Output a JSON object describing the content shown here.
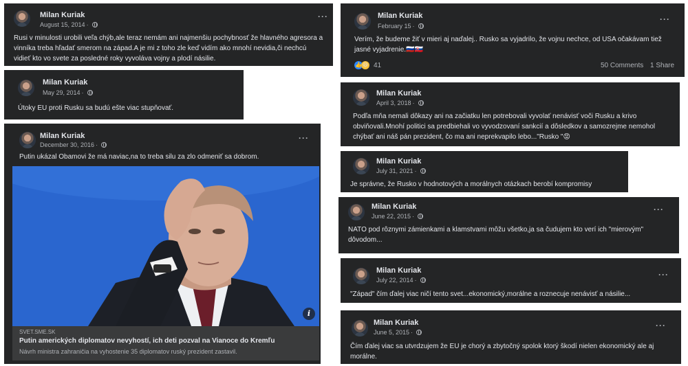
{
  "author": "Milan Kuriak",
  "more_label": "···",
  "posts": [
    {
      "id": "p1",
      "date": "August 15, 2014",
      "text": "Rusi v minulosti urobili veľa chýb,ale teraz nemám ani najmenšiu pochybnosť že hlavného agresora a vinníka treba hľadať smerom na západ.A je mi z toho zle keď vidím ako mnohí nevidia,či nechcú vidieť kto vo svete za posledné roky vyvoláva vojny a plodí násilie."
    },
    {
      "id": "p2",
      "date": "May 29, 2014",
      "text": "Útoky EU proti Rusku sa budú ešte viac stupňovať."
    },
    {
      "id": "p3",
      "date": "December 30, 2016",
      "text": "Putin ukázal Obamovi že  má naviac,na to treba silu za zlo odmeniť  sa dobrom.",
      "link": {
        "domain": "SVET.SME.SK",
        "title": "Putin amerických diplomatov nevyhostí, ich deti pozval na Vianoce do Kremľu",
        "description": "Návrh ministra zahraničia na vyhostenie 35 diplomatov ruský prezident zastavil.",
        "info_label": "i"
      }
    },
    {
      "id": "p4",
      "date": "February 15",
      "text": "Verím, že  budeme žiť v mieri aj naďalej.. Rusko sa vyjadrilo, že vojnu nechce, od USA očakávam tiež jasné vyjadrenie.🇷🇺🇸🇰",
      "reactions_count": "41",
      "comments": "50 Comments",
      "shares": "1 Share"
    },
    {
      "id": "p5",
      "date": "April 3, 2018",
      "text": "Podľa mňa nemali dôkazy ani na začiatku len potrebovali vyvolať nenávisť voči Rusku a krivo obviňovali.Mnohí politici sa predbiehali vo vyvodzovaní sankcií a dôsledkov a samozrejme nemohol chýbať ani náš pán prezident, čo ma ani neprekvapilo lebo...\"Rusko \"😡"
    },
    {
      "id": "p6",
      "date": "July 31, 2021",
      "text": "Je správne, že Rusko v hodnotových a morálnych otázkach berobí kompromisy"
    },
    {
      "id": "p7",
      "date": "June 22, 2015",
      "text": "NATO pod rôznymi zámienkami a klamstvami môžu všetko,ja sa čudujem kto verí ich  \"mierovým\" dôvodom..."
    },
    {
      "id": "p8",
      "date": "July 22, 2014",
      "text": "\"Západ\" čím ďalej viac ničí tento svet...ekonomický,morálne a roznecuje nenávisť a násilie..."
    },
    {
      "id": "p9",
      "date": "June 5, 2015",
      "text": "Čím ďalej viac sa utvrdzujem že EU je chorý a zbytočný spolok ktorý  škodí nielen ekonomický ale aj morálne."
    }
  ]
}
